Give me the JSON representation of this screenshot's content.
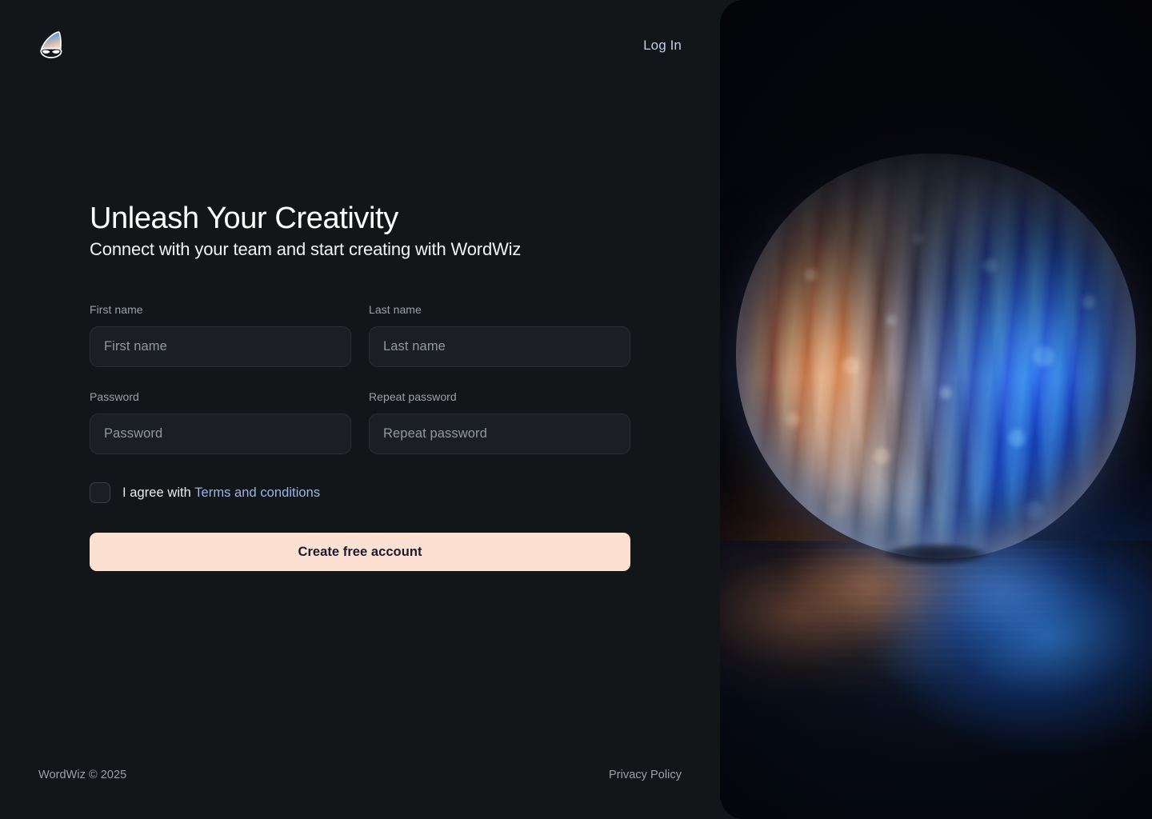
{
  "brand": {
    "logo_icon": "wizard-hat-icon",
    "name": "WordWiz"
  },
  "header": {
    "login_label": "Log In"
  },
  "hero": {
    "headline": "Unleash Your Creativity",
    "subheadline": "Connect with your team and start creating with WordWiz"
  },
  "form": {
    "fields": [
      {
        "name": "first-name",
        "label": "First name",
        "placeholder": "First name",
        "value": "",
        "type": "text"
      },
      {
        "name": "last-name",
        "label": "Last name",
        "placeholder": "Last name",
        "value": "",
        "type": "text"
      },
      {
        "name": "password",
        "label": "Password",
        "placeholder": "Password",
        "value": "",
        "type": "password"
      },
      {
        "name": "repeat-password",
        "label": "Repeat password",
        "placeholder": "Repeat password",
        "value": "",
        "type": "password"
      }
    ],
    "terms": {
      "checked": false,
      "text": "I agree with",
      "link_label": "Terms and conditions"
    },
    "submit_label": "Create free account"
  },
  "footer": {
    "copyright": "WordWiz © 2025",
    "privacy_label": "Privacy Policy"
  },
  "artwork": {
    "description": "Abstract 3D glossy glass orb with copper and blue iridescent reflections on a dark reflective surface",
    "accent_blue": "#2f72d8",
    "accent_copper": "#d9895a",
    "background": "#05060a"
  },
  "colors": {
    "page_background": "#131619",
    "input_background": "#1b1f24",
    "input_border": "#2b2f35",
    "cta_background": "#fce0d1",
    "cta_text": "#1b1b30",
    "link_blue": "#9ab4e6",
    "muted_text": "#9aa0a6"
  }
}
